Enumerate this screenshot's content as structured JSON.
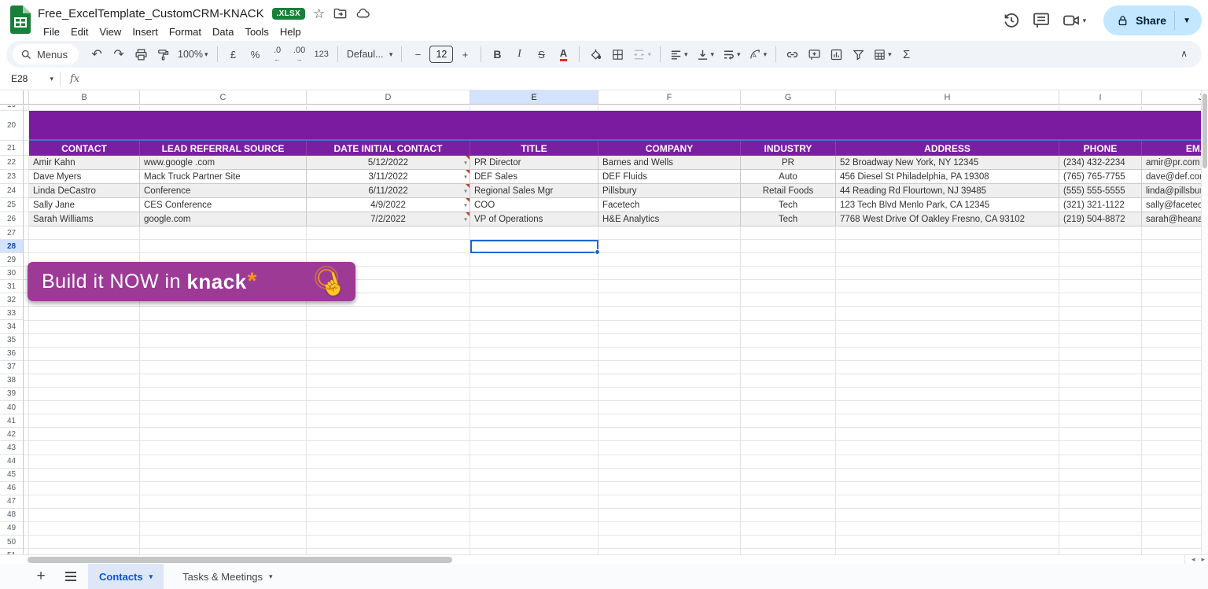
{
  "window": {
    "title": "Free_ExcelTemplate_CustomCRM-KNACK",
    "badge": ".XLSX",
    "share_label": "Share"
  },
  "menus": [
    "File",
    "Edit",
    "View",
    "Insert",
    "Format",
    "Data",
    "Tools",
    "Help"
  ],
  "toolbar": {
    "menus_label": "Menus",
    "zoom": "100%",
    "currency": "£",
    "percent": "%",
    "decimal_decrease": ".0",
    "decimal_decrease_arrow": "←",
    "decimal_increase": ".00",
    "decimal_increase_arrow": "→",
    "more_formats": "123",
    "font_name": "Defaul...",
    "font_size_minus": "−",
    "font_size": "12",
    "font_size_plus": "+",
    "bold": "B",
    "italic": "I",
    "strikethrough": "S",
    "text_color": "A",
    "rotate_letter": "A",
    "sigma": "Σ",
    "caret": "▾",
    "collapse": "∧"
  },
  "formula_bar": {
    "cell_ref": "E28",
    "fx_label": "fx"
  },
  "grid": {
    "columns": [
      "B",
      "C",
      "D",
      "E",
      "F",
      "G",
      "H",
      "I",
      "J"
    ],
    "first_row": 19,
    "last_row": 51,
    "selected_column": "E",
    "selected_row": 28,
    "selected_cell": "E28"
  },
  "table": {
    "headers": [
      "CONTACT",
      "LEAD REFERRAL SOURCE",
      "DATE INITIAL CONTACT",
      "TITLE",
      "COMPANY",
      "INDUSTRY",
      "ADDRESS",
      "PHONE",
      "EMAIL"
    ],
    "rows": [
      {
        "contact": "Amir Kahn",
        "source": "www.google .com",
        "date": "5/12/2022",
        "title": "PR Director",
        "company": "Barnes and Wells",
        "industry": "PR",
        "address": "52 Broadway New York, NY 12345",
        "phone": "(234) 432-2234",
        "email": "amir@pr.com"
      },
      {
        "contact": "Dave Myers",
        "source": "Mack Truck Partner Site",
        "date": "3/11/2022",
        "title": "DEF Sales",
        "company": "DEF Fluids",
        "industry": "Auto",
        "address": "456 Diesel St Philadelphia, PA 19308",
        "phone": "(765) 765-7755",
        "email": "dave@def.cor"
      },
      {
        "contact": "Linda DeCastro",
        "source": "Conference",
        "date": "6/11/2022",
        "title": "Regional Sales Mgr",
        "company": "Pillsbury",
        "industry": "Retail Foods",
        "address": "44 Reading Rd Flourtown, NJ 39485",
        "phone": "(555) 555-5555",
        "email": "linda@pillsbury"
      },
      {
        "contact": "Sally Jane",
        "source": "CES Conference",
        "date": "4/9/2022",
        "title": "COO",
        "company": "Facetech",
        "industry": "Tech",
        "address": "123 Tech Blvd Menlo Park, CA 12345",
        "phone": "(321) 321-1122",
        "email": "sally@facetec"
      },
      {
        "contact": "Sarah Williams",
        "source": "google.com",
        "date": "7/2/2022",
        "title": "VP of Operations",
        "company": "H&E Analytics",
        "industry": "Tech",
        "address": "7768 West Drive Of Oakley Fresno, CA 93102",
        "phone": "(219) 504-8872",
        "email": "sarah@heanal"
      }
    ]
  },
  "banner": {
    "text": "Build it NOW in ",
    "brand": "knack",
    "asterisk": "*"
  },
  "sheetbar": {
    "tabs": [
      {
        "label": "Contacts",
        "active": true
      },
      {
        "label": "Tasks & Meetings",
        "active": false
      }
    ]
  },
  "icons": {
    "topbar": [
      "sheets-logo-icon",
      "star-icon",
      "move-folder-icon",
      "cloud-status-icon",
      "history-icon",
      "comment-icon",
      "video-call-icon",
      "lock-icon"
    ],
    "toolbar": [
      "search-icon",
      "undo-icon",
      "redo-icon",
      "print-icon",
      "paint-format-icon",
      "fill-color-icon",
      "borders-icon",
      "merge-cells-icon",
      "align-icon",
      "vertical-align-icon",
      "text-wrap-icon",
      "text-rotate-icon",
      "link-icon",
      "comment-add-icon",
      "chart-icon",
      "filter-icon",
      "table-icon",
      "functions-icon"
    ]
  },
  "colors": {
    "header_purple": "#7b1fa2",
    "band_purple": "#7a1ba0",
    "separator_blue": "#4573c4",
    "banner_purple": "#9c3a96",
    "banner_orange": "#f7941d",
    "selection_blue": "#1967d2",
    "share_bg": "#c2e7ff",
    "badge_green": "#188038",
    "active_tab_text": "#0b57d0",
    "row_band_gray": "#efefef"
  }
}
